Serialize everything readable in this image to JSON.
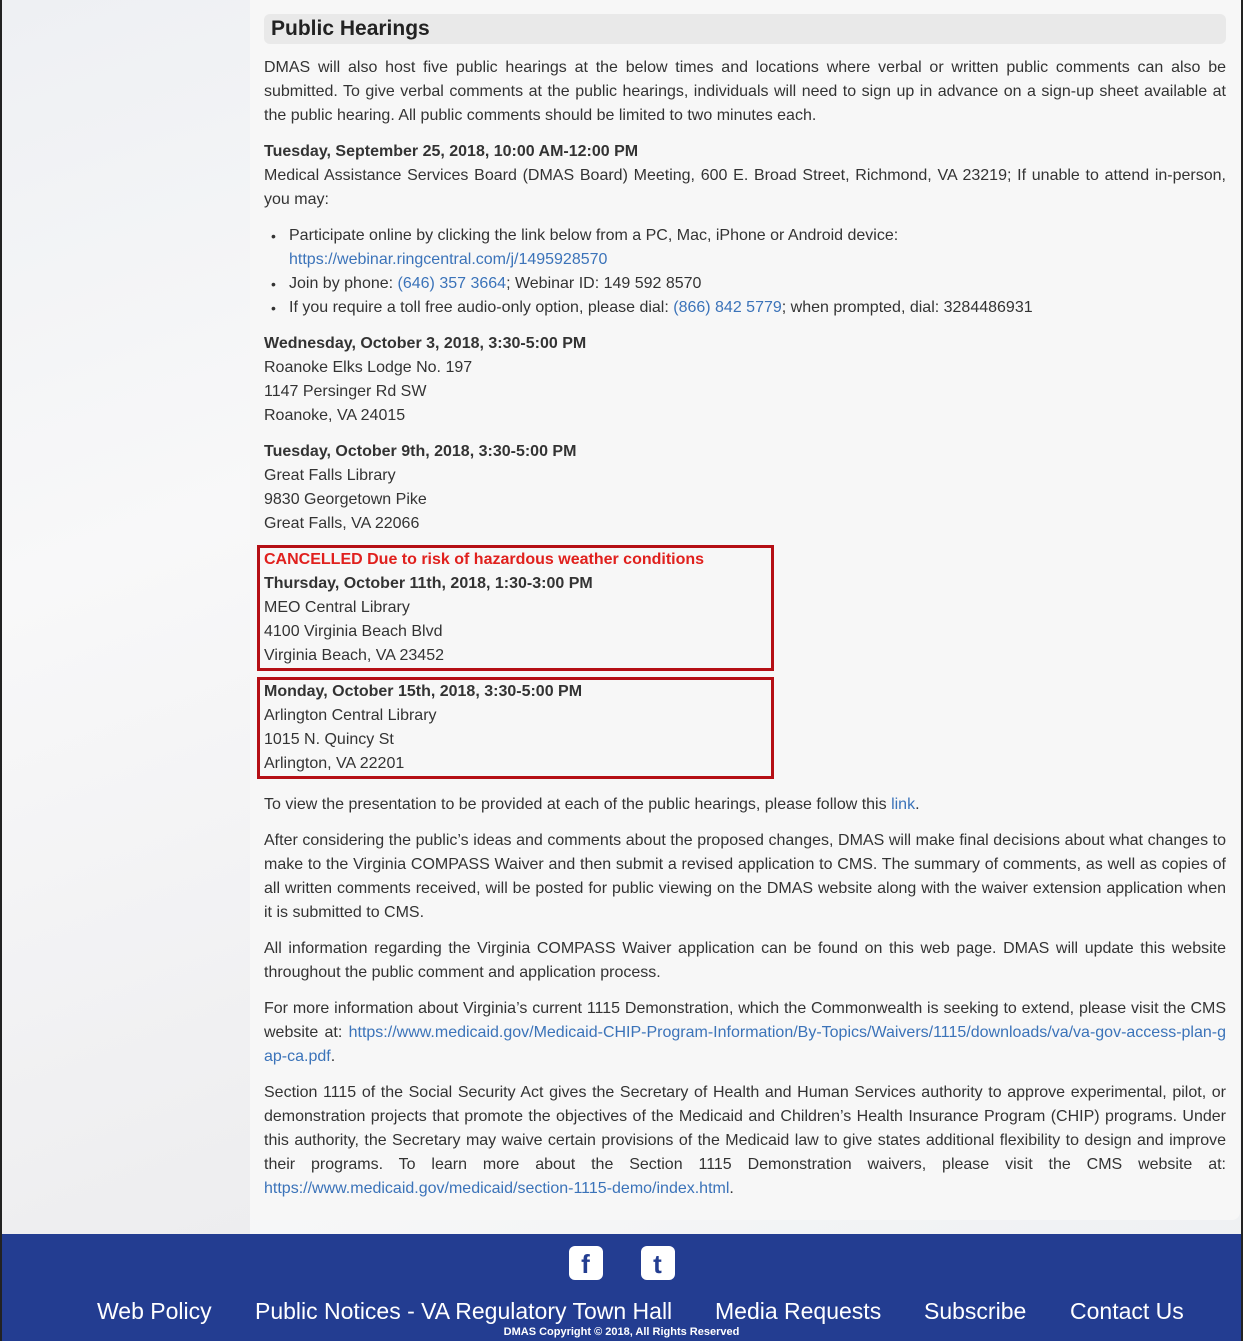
{
  "section": {
    "title": "Public Hearings",
    "intro": "DMAS will also host five public hearings at the below times and locations where verbal or written public comments can also be submitted. To give verbal comments at the public hearings, individuals will need to sign up in advance on a sign-up sheet available at the public hearing. All public comments should be limited to two minutes each."
  },
  "hearings": [
    {
      "date": "Tuesday, September 25, 2018, 10:00 AM-12:00 PM",
      "detail": "Medical Assistance Services Board (DMAS Board) Meeting, 600 E. Broad Street, Richmond, VA 23219; If unable to attend in-person, you may:",
      "options": {
        "online_text": "Participate online by clicking the link below from a PC, Mac, iPhone or Android device:",
        "online_link": "https://webinar.ringcentral.com/j/1495928570",
        "phone_prefix": "Join by phone: ",
        "phone_link": "(646) 357 3664",
        "phone_suffix": "; Webinar ID: 149 592 8570",
        "tollfree_prefix": "If you require a toll free audio-only option, please dial: ",
        "tollfree_link": "(866) 842 5779",
        "tollfree_suffix": "; when prompted, dial: 3284486931"
      }
    },
    {
      "date": "Wednesday, October 3, 2018, 3:30-5:00 PM",
      "line1": "Roanoke Elks Lodge No. 197",
      "line2": "1147 Persinger Rd SW",
      "line3": "Roanoke, VA 24015"
    },
    {
      "date": "Tuesday, October 9th, 2018, 3:30-5:00 PM",
      "line1": "Great Falls Library",
      "line2": "9830 Georgetown Pike",
      "line3": "Great Falls, VA 22066"
    },
    {
      "notice": "CANCELLED Due to risk of hazardous weather conditions",
      "date": "Thursday, October 11th, 2018, 1:30-3:00 PM",
      "line1": "MEO Central Library",
      "line2": "4100 Virginia Beach Blvd",
      "line3": "Virginia Beach, VA 23452"
    },
    {
      "date": "Monday, October 15th, 2018, 3:30-5:00 PM",
      "line1": "Arlington Central Library",
      "line2": "1015 N. Quincy St",
      "line3": "Arlington, VA 22201"
    }
  ],
  "body": {
    "presentation_prefix": "To view the presentation to be provided at each of the public hearings, please follow this ",
    "presentation_link": "link",
    "presentation_suffix": ".",
    "after": "After considering the public’s ideas and comments about the proposed changes, DMAS will make final decisions about what changes to make to the Virginia COMPASS Waiver and then submit a revised application to CMS. The summary of comments, as well as copies of all written comments received, will be posted for public viewing on the DMAS website along with the waiver extension application when it is submitted to CMS.",
    "all_info": "All information regarding the Virginia COMPASS Waiver application can be found on this web page. DMAS will update this website throughout the public comment and application process.",
    "more_info_prefix": "For more information about Virginia’s current 1115 Demonstration, which the Commonwealth is seeking to extend, please visit the CMS website at: ",
    "more_info_link": "https://www.medicaid.gov/Medicaid-CHIP-Program-Information/By-Topics/Waivers/1115/downloads/va/va-gov-access-plan-gap-ca.pdf",
    "more_info_suffix": ".",
    "section1115_prefix": "Section 1115 of the Social Security Act gives the Secretary of Health and Human Services authority to approve experimental, pilot, or demonstration projects that promote the objectives of the Medicaid and Children’s Health Insurance Program (CHIP) programs. Under this authority, the Secretary may waive certain provisions of the Medicaid law to give states additional flexibility to design and improve their programs. To learn more about the Section 1115 Demonstration waivers, please visit the CMS website at: ",
    "section1115_link": "https://www.medicaid.gov/medicaid/section-1115-demo/index.html",
    "section1115_suffix": "."
  },
  "footer": {
    "social": {
      "facebook_icon": "f",
      "twitter_icon": "t"
    },
    "nav": [
      "Web Policy",
      "Public Notices - VA Regulatory Town Hall",
      "Media Requests",
      "Subscribe",
      "Contact Us"
    ],
    "copyright": "DMAS Copyright © 2018, All Rights Reserved"
  }
}
